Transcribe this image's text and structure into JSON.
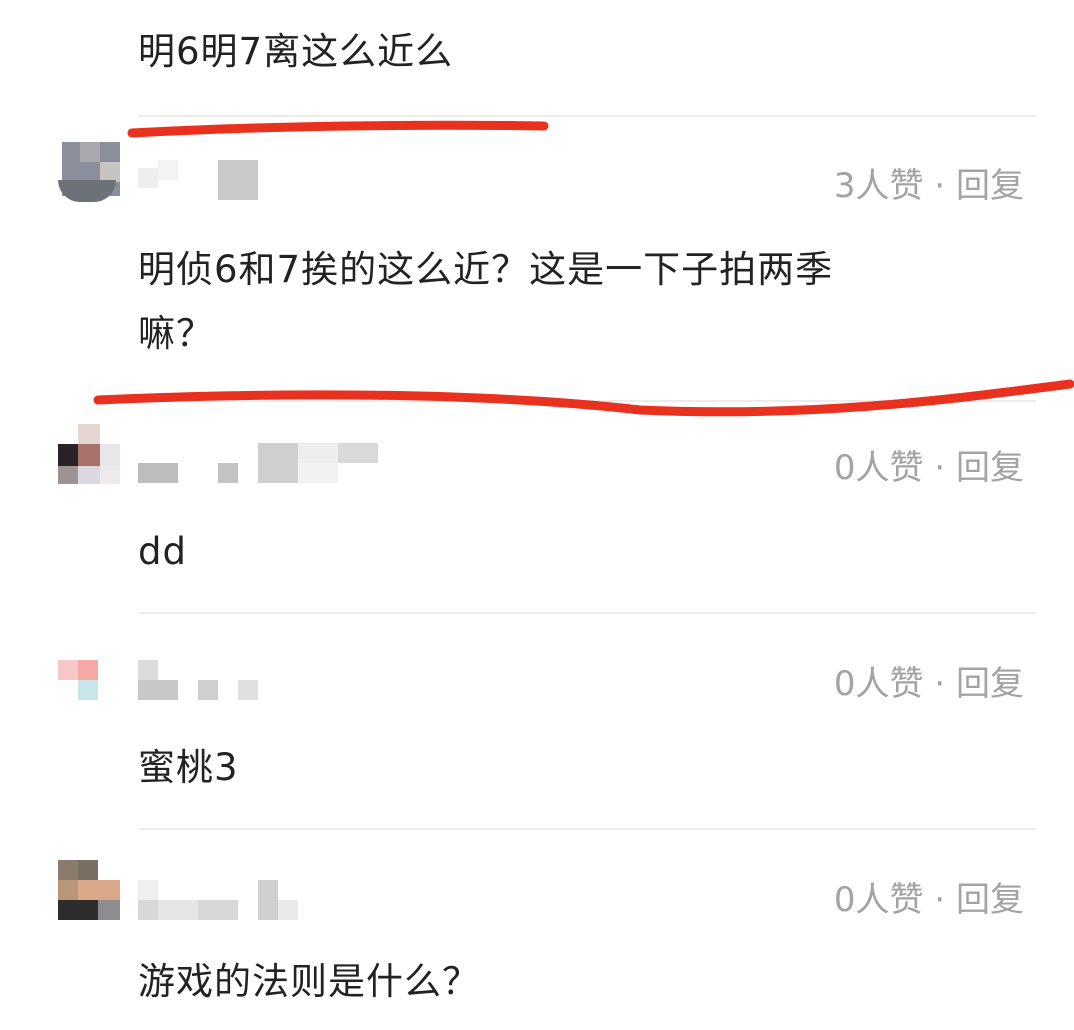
{
  "top_comment": {
    "text": "明6明7离这么近么"
  },
  "comments": [
    {
      "likes": "3人赞",
      "separator": "·",
      "reply_label": "回复",
      "text_line1": "明侦6和7挨的这么近？这是一下子拍两季",
      "text_line2": "嘛？"
    },
    {
      "likes": "0人赞",
      "separator": "·",
      "reply_label": "回复",
      "text": "dd"
    },
    {
      "likes": "0人赞",
      "separator": "·",
      "reply_label": "回复",
      "text": "蜜桃3"
    },
    {
      "likes": "0人赞",
      "separator": "·",
      "reply_label": "回复",
      "text": "游戏的法则是什么？"
    }
  ],
  "colors": {
    "annotation_underline": "#e8321f",
    "meta_text": "#a3a3a3",
    "body_text": "#222222",
    "divider": "#ececec"
  },
  "icons": [
    "avatar-image",
    "blurred-username"
  ]
}
